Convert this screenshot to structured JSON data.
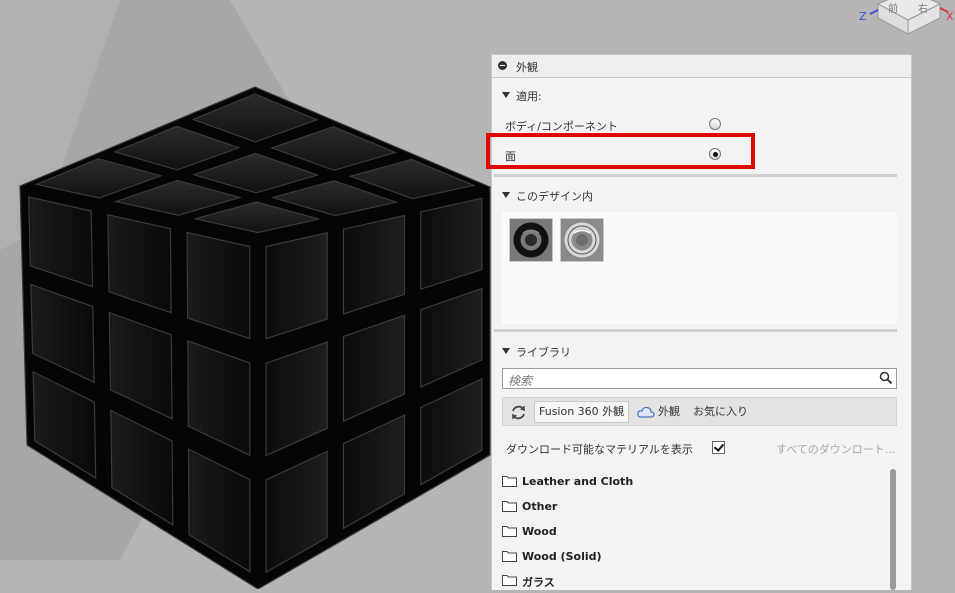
{
  "viewcube": {
    "axis_z": "Z",
    "axis_x": "X",
    "face_front": "前",
    "face_right": "右"
  },
  "panel": {
    "title": "外観",
    "apply_section": {
      "label": "適用:",
      "options": [
        {
          "label": "ボディ/コンポーネント",
          "selected": false
        },
        {
          "label": "面",
          "selected": true
        }
      ]
    },
    "in_design_section": {
      "label": "このデザイン内",
      "swatches": [
        {
          "icon": "dark-ring-material"
        },
        {
          "icon": "silver-ring-material"
        }
      ]
    },
    "library_section": {
      "label": "ライブラリ",
      "search_placeholder": "検索",
      "tabs": [
        {
          "label": "Fusion 360 外観",
          "active": true
        },
        {
          "label": "外観",
          "active": false
        },
        {
          "label": "お気に入り",
          "active": false
        }
      ],
      "download_toggle_label": "ダウンロード可能なマテリアルを表示",
      "download_toggle_checked": true,
      "download_all_label": "すべてのダウンロート...",
      "folders": [
        "Leather and Cloth",
        "Other",
        "Wood",
        "Wood (Solid)",
        "ガラス"
      ]
    }
  },
  "colors": {
    "highlight": "#e30000",
    "axis_z": "#3b55d6",
    "axis_x": "#d63b3b",
    "background": "#b5b5b5"
  }
}
